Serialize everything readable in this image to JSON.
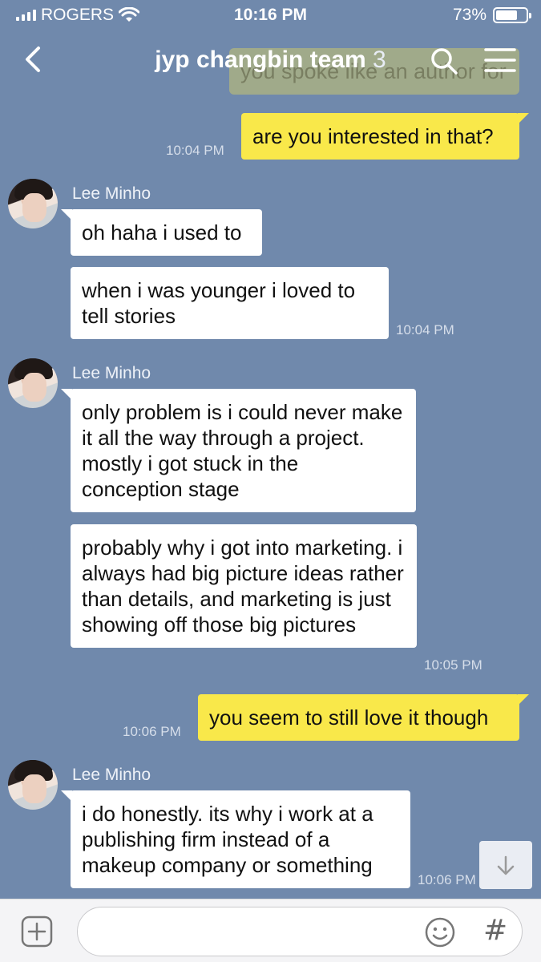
{
  "status_bar": {
    "carrier": "ROGERS",
    "time": "10:16 PM",
    "battery": "73%",
    "battery_level": 0.73
  },
  "header": {
    "back_icon": "chevron-left-icon",
    "title": "jyp changbin team",
    "member_count": "3",
    "search_icon": "search-icon",
    "menu_icon": "hamburger-menu-icon",
    "partial_message": "you spoke like an author for"
  },
  "messages": [
    {
      "from": "me",
      "text": "are you interested in that?",
      "time": "10:04 PM"
    },
    {
      "from": "Lee Minho",
      "sender": "Lee Minho",
      "text": "oh haha i used to"
    },
    {
      "from": "Lee Minho",
      "text": "when i was younger i loved to tell stories",
      "time": "10:04 PM"
    },
    {
      "from": "Lee Minho",
      "sender": "Lee Minho",
      "text": "only problem is i could never make it all the way through a project. mostly i got stuck in the conception stage"
    },
    {
      "from": "Lee Minho",
      "text": "probably why i got into marketing. i always had big picture ideas rather than details, and marketing is just showing off those big pictures",
      "time": "10:05 PM"
    },
    {
      "from": "me",
      "text": "you seem to still love it though",
      "time": "10:06 PM"
    },
    {
      "from": "Lee Minho",
      "sender": "Lee Minho",
      "text": "i do honestly. its why i work at a publishing firm instead of a makeup company or something",
      "time": "10:06 PM"
    }
  ],
  "input_bar": {
    "add_icon": "plus-square-icon",
    "placeholder": "",
    "emoji_icon": "smiley-icon",
    "hashtag_label": "#"
  },
  "scroll_down_icon": "arrow-down-icon",
  "colors": {
    "background": "#7089ac",
    "my_bubble": "#f9e84a",
    "their_bubble": "#ffffff"
  }
}
